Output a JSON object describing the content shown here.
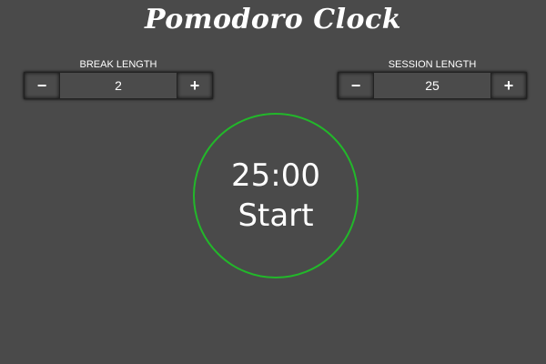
{
  "header": {
    "title": "Pomodoro Clock"
  },
  "break": {
    "label": "BREAK LENGTH",
    "decrement": "−",
    "value": "2",
    "increment": "+"
  },
  "session": {
    "label": "SESSION LENGTH",
    "decrement": "−",
    "value": "25",
    "increment": "+"
  },
  "timer": {
    "time": "25:00",
    "state": "Start",
    "ring_color": "#22b82a"
  },
  "colors": {
    "background": "#4a4a4a",
    "accent": "#22b82a"
  }
}
